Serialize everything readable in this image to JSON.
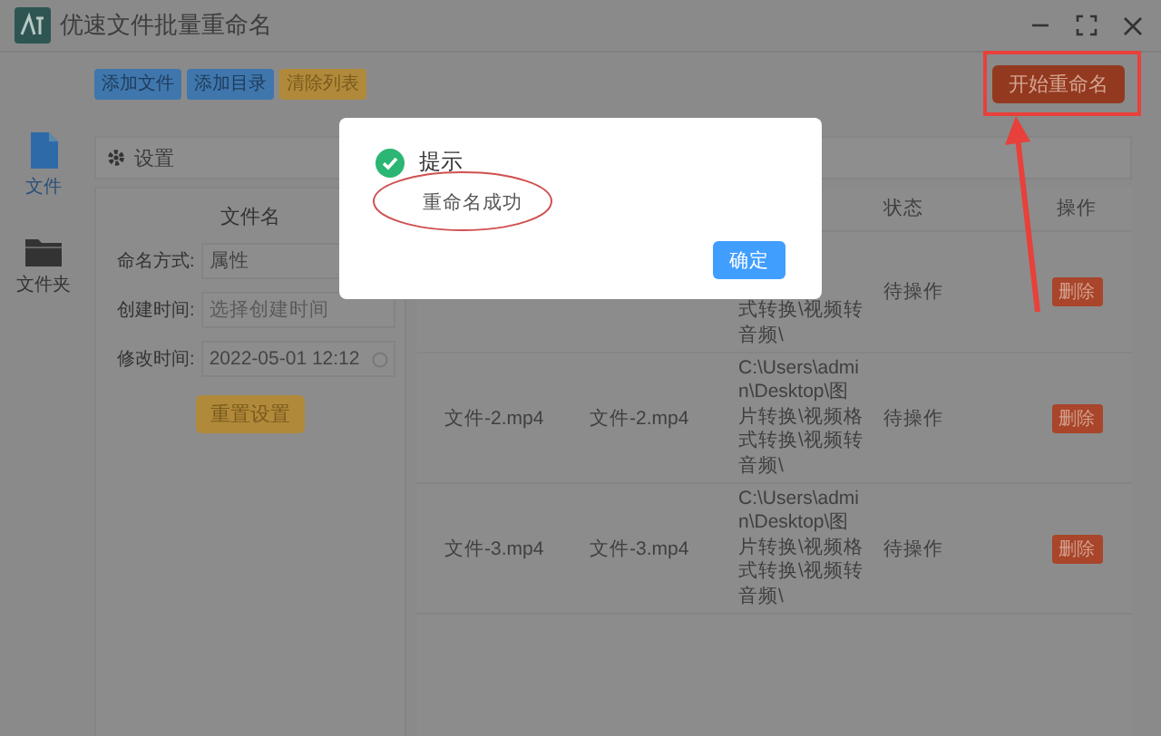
{
  "window": {
    "title": "优速文件批量重命名"
  },
  "toolbar": {
    "buttons": [
      {
        "label": "添加文件",
        "kind": "primary"
      },
      {
        "label": "添加目录",
        "kind": "primary"
      },
      {
        "label": "清除列表",
        "kind": "warning"
      }
    ],
    "start_button": "开始重命名"
  },
  "sidebar": {
    "items": [
      {
        "label": "文件",
        "kind": "file",
        "selected": true
      },
      {
        "label": "文件夹",
        "kind": "folder",
        "selected": false
      }
    ]
  },
  "settings": {
    "title": "设置",
    "section": "文件名",
    "fields": [
      {
        "label": "命名方式:",
        "kind": "select",
        "value": "属性"
      },
      {
        "label": "创建时间:",
        "kind": "datetime",
        "placeholder": "选择创建时间"
      },
      {
        "label": "修改时间:",
        "kind": "datetime",
        "value": "2022-05-01 12:12"
      }
    ],
    "reset_button": "重置设置"
  },
  "table": {
    "columns": [
      {
        "label": "状态"
      },
      {
        "label": "操作"
      }
    ],
    "rows": [
      {
        "path": "式转换\\视频转音频\\",
        "status": "待操作",
        "action": "删除"
      },
      {
        "name": "文件-2.mp4",
        "new_name": "文件-2.mp4",
        "path": "C:\\Users\\admin\\Desktop\\图片转换\\视频格式转换\\视频转音频\\",
        "status": "待操作",
        "action": "删除"
      },
      {
        "name": "文件-3.mp4",
        "new_name": "文件-3.mp4",
        "path": "C:\\Users\\admin\\Desktop\\图片转换\\视频格式转换\\视频转音频\\",
        "status": "待操作",
        "action": "删除"
      }
    ]
  },
  "dialog": {
    "kind": "success",
    "title": "提示",
    "message": "重命名成功",
    "button": "确定"
  }
}
